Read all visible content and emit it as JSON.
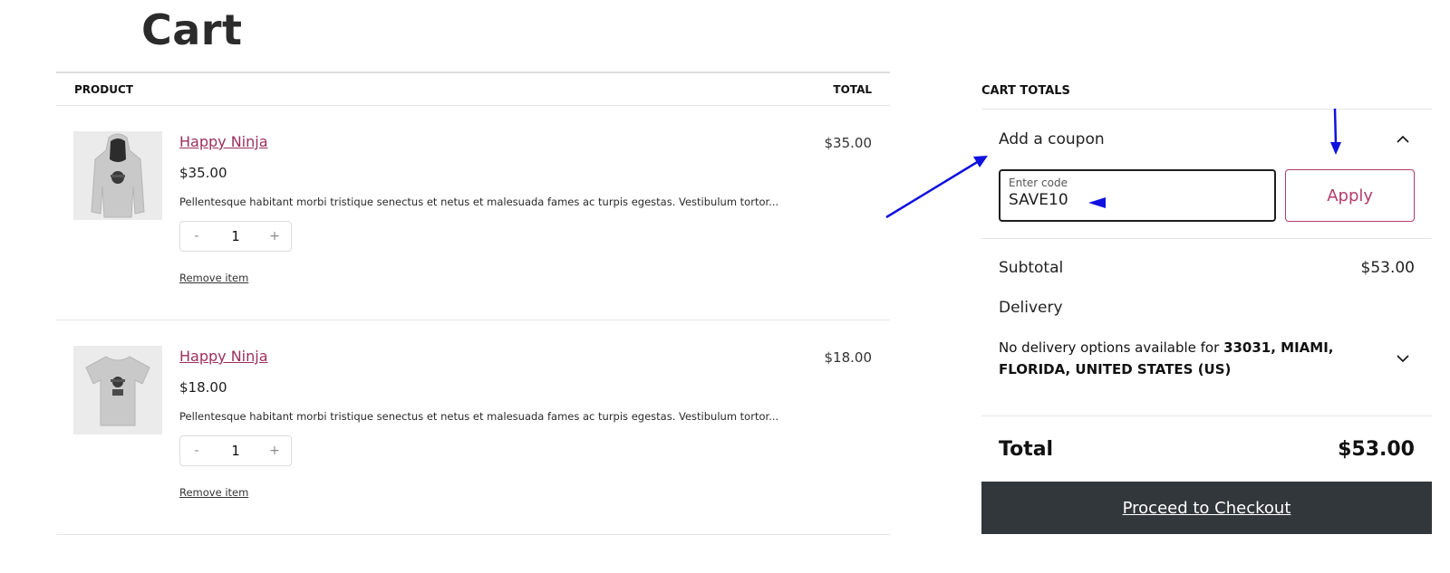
{
  "page": {
    "title": "Cart"
  },
  "table": {
    "headers": {
      "product": "PRODUCT",
      "total": "TOTAL"
    },
    "items": [
      {
        "name": "Happy Ninja",
        "price": "$35.00",
        "description": "Pellentesque habitant morbi tristique senectus et netus et malesuada fames ac turpis egestas. Vestibulum tortor...",
        "quantity": "1",
        "qty_minus": "-",
        "qty_plus": "+",
        "remove_label": "Remove item",
        "line_total": "$35.00",
        "image": "hoodie-image"
      },
      {
        "name": "Happy Ninja",
        "price": "$18.00",
        "description": "Pellentesque habitant morbi tristique senectus et netus et malesuada fames ac turpis egestas. Vestibulum tortor...",
        "quantity": "1",
        "qty_minus": "-",
        "qty_plus": "+",
        "remove_label": "Remove item",
        "line_total": "$18.00",
        "image": "tshirt-image"
      }
    ]
  },
  "totals": {
    "heading": "CART TOTALS",
    "coupon": {
      "title": "Add a coupon",
      "field_label": "Enter code",
      "value": "SAVE10",
      "apply_label": "Apply"
    },
    "subtotal_label": "Subtotal",
    "subtotal_value": "$53.00",
    "delivery_label": "Delivery",
    "delivery_prefix": "No delivery options available for ",
    "delivery_address": "33031, MIAMI, FLORIDA, UNITED STATES (US)",
    "total_label": "Total",
    "total_value": "$53.00",
    "checkout_label": "Proceed to Checkout"
  },
  "colors": {
    "accent": "#b43c6a",
    "link": "#9b2f5c",
    "checkout_bg": "#32373c",
    "annotation": "#1010e0"
  }
}
